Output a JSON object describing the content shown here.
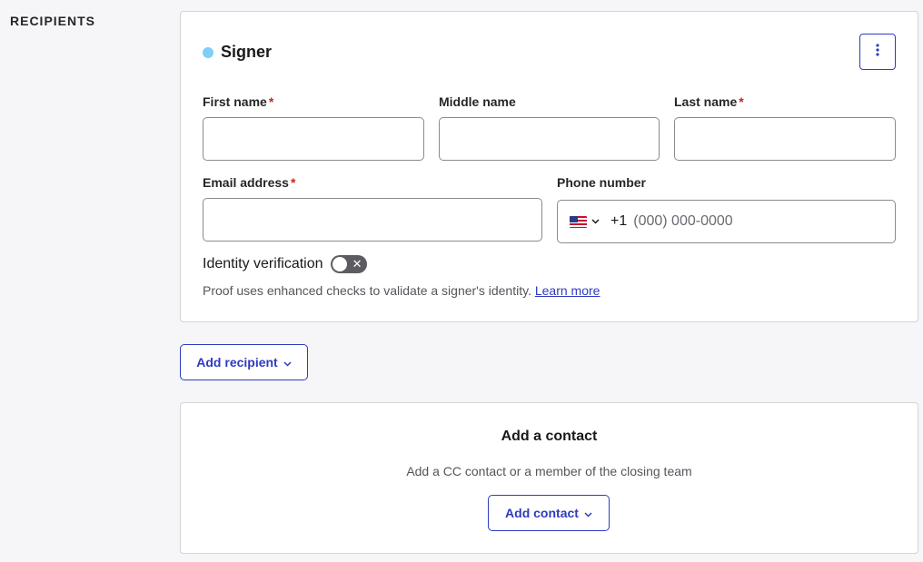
{
  "section": {
    "label": "RECIPIENTS"
  },
  "signer": {
    "title": "Signer",
    "dot_color": "#7fcff6",
    "menu_icon": "kebab-vertical-icon",
    "fields": {
      "first_name": {
        "label": "First name",
        "required": "*",
        "value": ""
      },
      "middle_name": {
        "label": "Middle name",
        "value": ""
      },
      "last_name": {
        "label": "Last name",
        "required": "*",
        "value": ""
      },
      "email": {
        "label": "Email address",
        "required": "*",
        "value": ""
      },
      "phone": {
        "label": "Phone number",
        "country_icon": "us-flag-icon",
        "country_code": "+1",
        "placeholder": "(000) 000-0000"
      }
    },
    "identity_verification": {
      "label": "Identity verification",
      "enabled": false,
      "helper": "Proof uses enhanced checks to validate a signer's identity.",
      "link": "Learn more"
    }
  },
  "add_recipient": {
    "label": "Add recipient"
  },
  "contact": {
    "title": "Add a contact",
    "subtitle": "Add a CC contact or a member of the closing team",
    "button_label": "Add contact"
  },
  "colors": {
    "accent": "#2f3bbf",
    "required": "#c5271b",
    "toggle_off": "#5c5c62"
  }
}
